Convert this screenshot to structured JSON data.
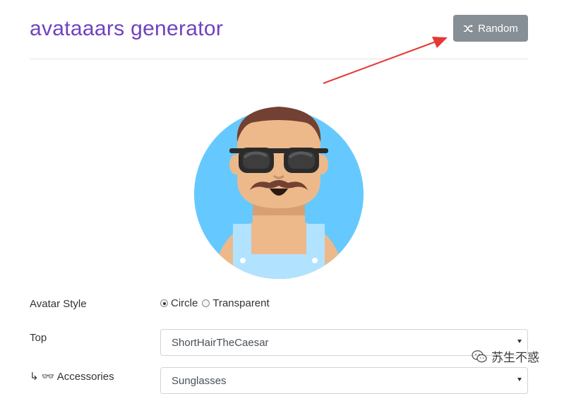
{
  "header": {
    "title": "avataaars generator",
    "random_label": "Random"
  },
  "form": {
    "avatar_style": {
      "label": "Avatar Style",
      "options": [
        {
          "label": "Circle",
          "checked": true
        },
        {
          "label": "Transparent",
          "checked": false
        }
      ]
    },
    "top": {
      "label": "Top",
      "value": "ShortHairTheCaesar"
    },
    "accessories": {
      "label": "↳ 👓 Accessories",
      "value": "Sunglasses"
    }
  },
  "watermark": {
    "text": "苏生不惑",
    "icon": "wechat-icon"
  },
  "colors": {
    "title": "#6f42c1",
    "button_bg": "#868e96",
    "avatar_bg": "#65c9ff",
    "skin": "#edb98a",
    "hair": "#724133",
    "shirt": "#b1e2ff",
    "arrow": "#e53935"
  }
}
